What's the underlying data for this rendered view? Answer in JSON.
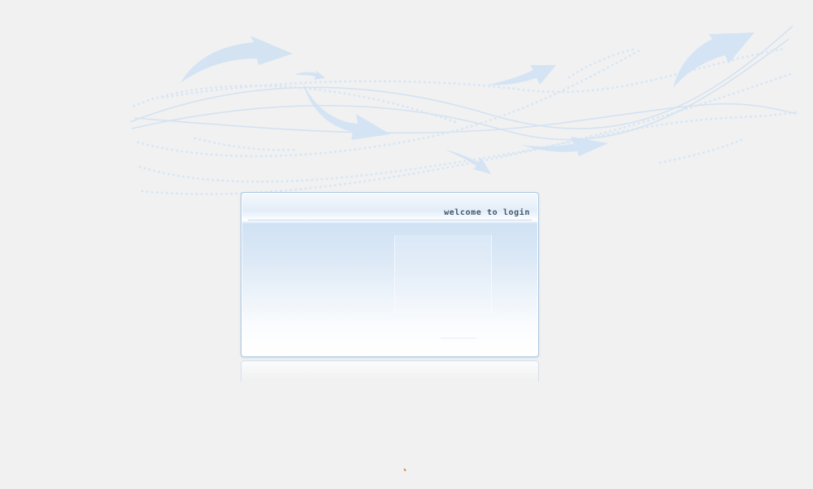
{
  "window": {
    "background": "#f1f1f1"
  },
  "login_panel": {
    "title": "welcome to login",
    "accent_color": "#aac6e4",
    "title_color": "#3e5670"
  },
  "decoration": {
    "arrow_color": "#d2e3f3",
    "dot_color": "#d7e6f5",
    "line_color": "#ccdff1"
  }
}
